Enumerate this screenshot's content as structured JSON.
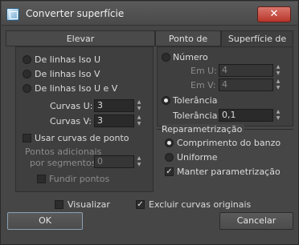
{
  "window": {
    "title": "Converter superfície"
  },
  "tabs": [
    {
      "label": "Elevar"
    },
    {
      "label": "Ponto de ajuste"
    },
    {
      "label": "Superfície de VC"
    }
  ],
  "left": {
    "radio_iso_u": "De linhas Iso U",
    "radio_iso_v": "De linhas Iso V",
    "radio_iso_uv": "De linhas Iso U e V",
    "curves_u_label": "Curvas U:",
    "curves_u_value": "3",
    "curves_v_label": "Curvas V:",
    "curves_v_value": "3",
    "use_point_curves": "Usar curvas de ponto",
    "extra_points_line1": "Pontos adicionais",
    "extra_points_line2": "por segmentos:",
    "extra_points_value": "0",
    "merge_points": "Fundir pontos"
  },
  "right": {
    "number_label": "Número",
    "in_u_label": "Em U:",
    "in_u_value": "4",
    "in_v_label": "Em V:",
    "in_v_value": "4",
    "tolerance_radio": "Tolerância",
    "tolerance_label": "Tolerância:",
    "tolerance_value": "0,1",
    "reparam_title": "Reparametrização",
    "chord_length": "Comprimento do banzo",
    "uniform": "Uniforme",
    "keep_param": "Manter parametrização"
  },
  "bottom": {
    "preview": "Visualizar",
    "exclude_original": "Excluir curvas originais",
    "ok": "OK",
    "cancel": "Cancelar"
  }
}
